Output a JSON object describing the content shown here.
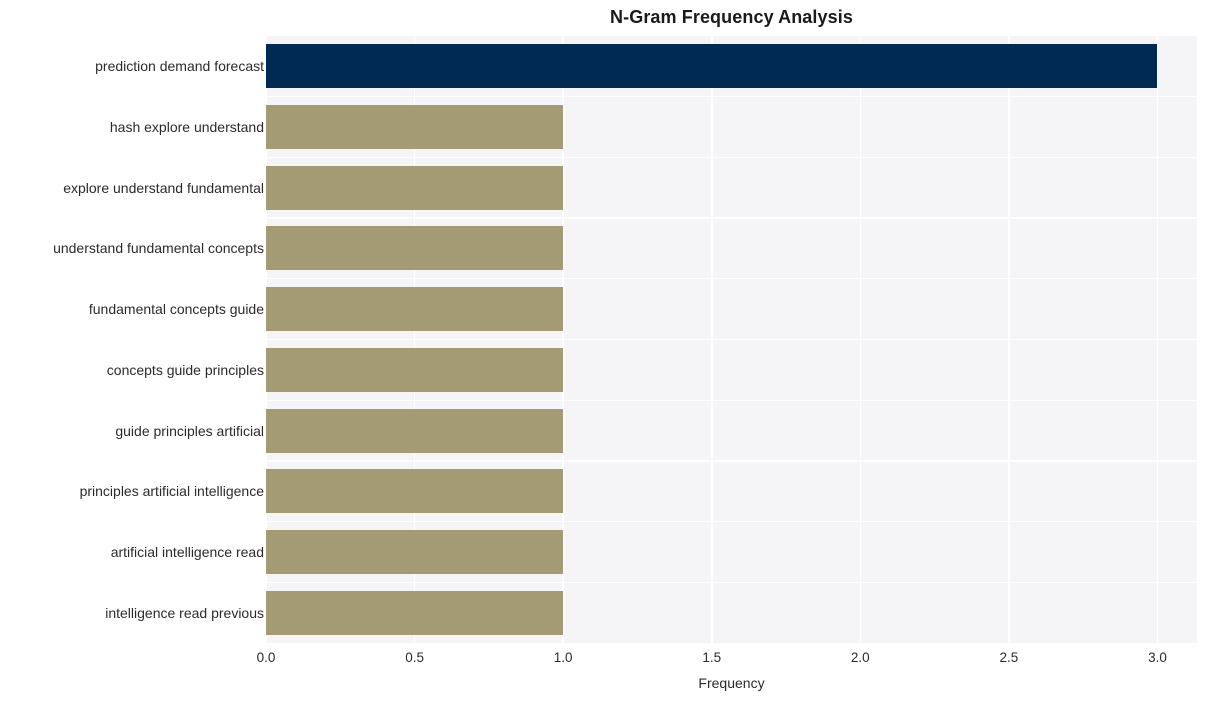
{
  "chart_data": {
    "type": "bar",
    "orientation": "horizontal",
    "title": "N-Gram Frequency Analysis",
    "xlabel": "Frequency",
    "ylabel": "",
    "categories": [
      "prediction demand forecast",
      "hash explore understand",
      "explore understand fundamental",
      "understand fundamental concepts",
      "fundamental concepts guide",
      "concepts guide principles",
      "guide principles artificial",
      "principles artificial intelligence",
      "artificial intelligence read",
      "intelligence read previous"
    ],
    "values": [
      3,
      1,
      1,
      1,
      1,
      1,
      1,
      1,
      1,
      1
    ],
    "bar_colors": [
      "#012a52",
      "#a49a74",
      "#a49a74",
      "#a49a74",
      "#a49a74",
      "#a49a74",
      "#a49a74",
      "#a49a74",
      "#a49a74",
      "#a49a74"
    ],
    "xlim": [
      0.0,
      3.133
    ],
    "xticks": [
      0.0,
      0.5,
      1.0,
      1.5,
      2.0,
      2.5,
      3.0
    ],
    "xtick_labels": [
      "0.0",
      "0.5",
      "1.0",
      "1.5",
      "2.0",
      "2.5",
      "3.0"
    ],
    "grid": true,
    "grid_color": "#ffffff",
    "plot_background": "#f5f5f7",
    "figure_background": "#ffffff",
    "legend": null
  }
}
